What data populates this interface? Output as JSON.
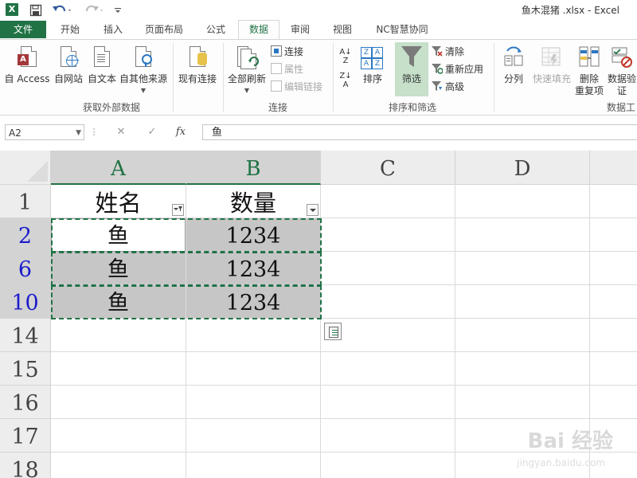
{
  "window": {
    "title": "鱼木混猪 .xlsx - Excel",
    "app_logo": "X",
    "qat_icons": [
      "save-icon",
      "undo-icon",
      "redo-icon",
      "customize-icon"
    ]
  },
  "tabs": [
    {
      "label": "文件",
      "active": false,
      "file": true
    },
    {
      "label": "开始",
      "active": false
    },
    {
      "label": "插入",
      "active": false
    },
    {
      "label": "页面布局",
      "active": false
    },
    {
      "label": "公式",
      "active": false
    },
    {
      "label": "数据",
      "active": true
    },
    {
      "label": "审阅",
      "active": false
    },
    {
      "label": "视图",
      "active": false
    },
    {
      "label": "NC智慧协同",
      "active": false
    }
  ],
  "ribbon": {
    "get_external": {
      "group_label": "获取外部数据",
      "from_access": "自 Access",
      "from_web": "自网站",
      "from_text": "自文本",
      "from_other": "自其他来源",
      "existing": "现有连接"
    },
    "connections": {
      "group_label": "连接",
      "refresh_all": "全部刷新",
      "connections": "连接",
      "properties": "属性",
      "edit_links": "编辑链接"
    },
    "sort_filter": {
      "group_label": "排序和筛选",
      "sort": "排序",
      "filter": "筛选",
      "clear": "清除",
      "reapply": "重新应用",
      "advanced": "高级"
    },
    "data_tools": {
      "group_label": "数据工",
      "split": "分列",
      "flash_fill": "快速填充",
      "remove_dup_1": "删除",
      "remove_dup_2": "重复项",
      "validation_1": "数据验",
      "validation_2": "证"
    }
  },
  "formula_bar": {
    "name_box": "A2",
    "cancel_glyph": "✕",
    "enter_glyph": "✓",
    "fx_label": "fx",
    "content": "鱼"
  },
  "sheet": {
    "columns": [
      "A",
      "B",
      "C",
      "D"
    ],
    "rows": [
      {
        "num": "1",
        "a": "姓名",
        "b": "数量"
      },
      {
        "num": "2",
        "a": "鱼",
        "b": "1234"
      },
      {
        "num": "6",
        "a": "鱼",
        "b": "1234"
      },
      {
        "num": "10",
        "a": "鱼",
        "b": "1234"
      },
      {
        "num": "14",
        "a": "",
        "b": ""
      },
      {
        "num": "15",
        "a": "",
        "b": ""
      },
      {
        "num": "16",
        "a": "",
        "b": ""
      },
      {
        "num": "17",
        "a": "",
        "b": ""
      },
      {
        "num": "18",
        "a": "",
        "b": ""
      }
    ]
  },
  "watermark": {
    "text": "Bai 经验",
    "sub": "jingyan.baidu.com"
  }
}
